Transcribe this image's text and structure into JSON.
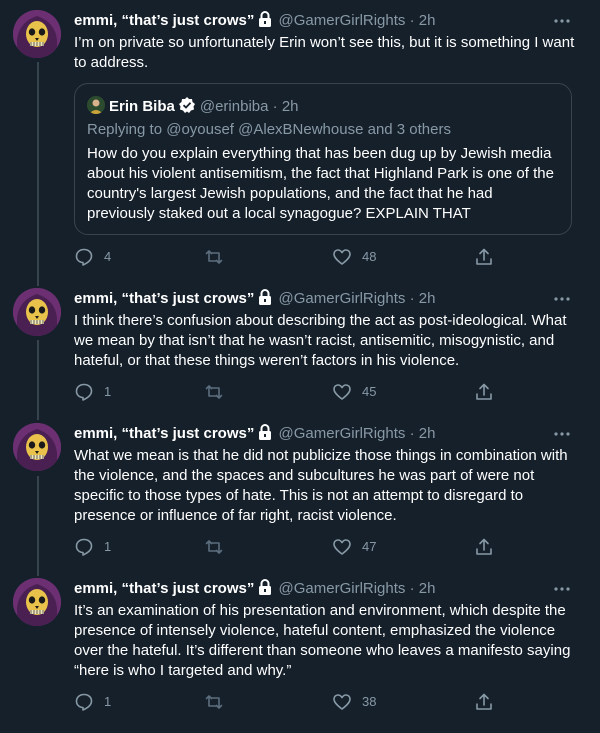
{
  "author": {
    "name": "emmi, “that’s just crows”",
    "handle": "@GamerGirlRights",
    "separator": "·"
  },
  "tweets": [
    {
      "time": "2h",
      "text": "I’m on private so unfortunately Erin won’t see this, but it is something I want to address.",
      "quote": {
        "name": "Erin Biba",
        "handle": "@erinbiba",
        "time": "2h",
        "replying_to": "Replying to @oyousef @AlexBNewhouse and 3 others",
        "text": "How do you explain everything that has been dug up by Jewish media about his violent antisemitism, the fact that Highland Park is one of the country's largest Jewish populations, and the fact that he had previously staked out a local synagogue? EXPLAIN THAT"
      },
      "replies": "4",
      "likes": "48"
    },
    {
      "time": "2h",
      "text": "I think there’s confusion about describing the act as post-ideological. What we mean by that isn’t that he wasn’t racist, antisemitic, misogynistic, and hateful, or that these things weren’t factors in his violence.",
      "replies": "1",
      "likes": "45"
    },
    {
      "time": "2h",
      "text": "What we mean is that he did not publicize those things in combination with the violence, and the spaces and subcultures he was part of were not specific to those types of hate. This is not an attempt to disregard to presence or influence of far right, racist violence.",
      "replies": "1",
      "likes": "47"
    },
    {
      "time": "2h",
      "text": "It’s an examination of his presentation and environment, which despite the presence of intensely violence, hateful content, emphasized the violence over the hateful. It’s different than someone who leaves a manifesto saying “here is who I targeted and why.”",
      "replies": "1",
      "likes": "38"
    }
  ],
  "colors": {
    "background": "#15202b",
    "secondary_text": "#8899a6",
    "border": "#38444d",
    "verified": "#1d9bf0"
  }
}
